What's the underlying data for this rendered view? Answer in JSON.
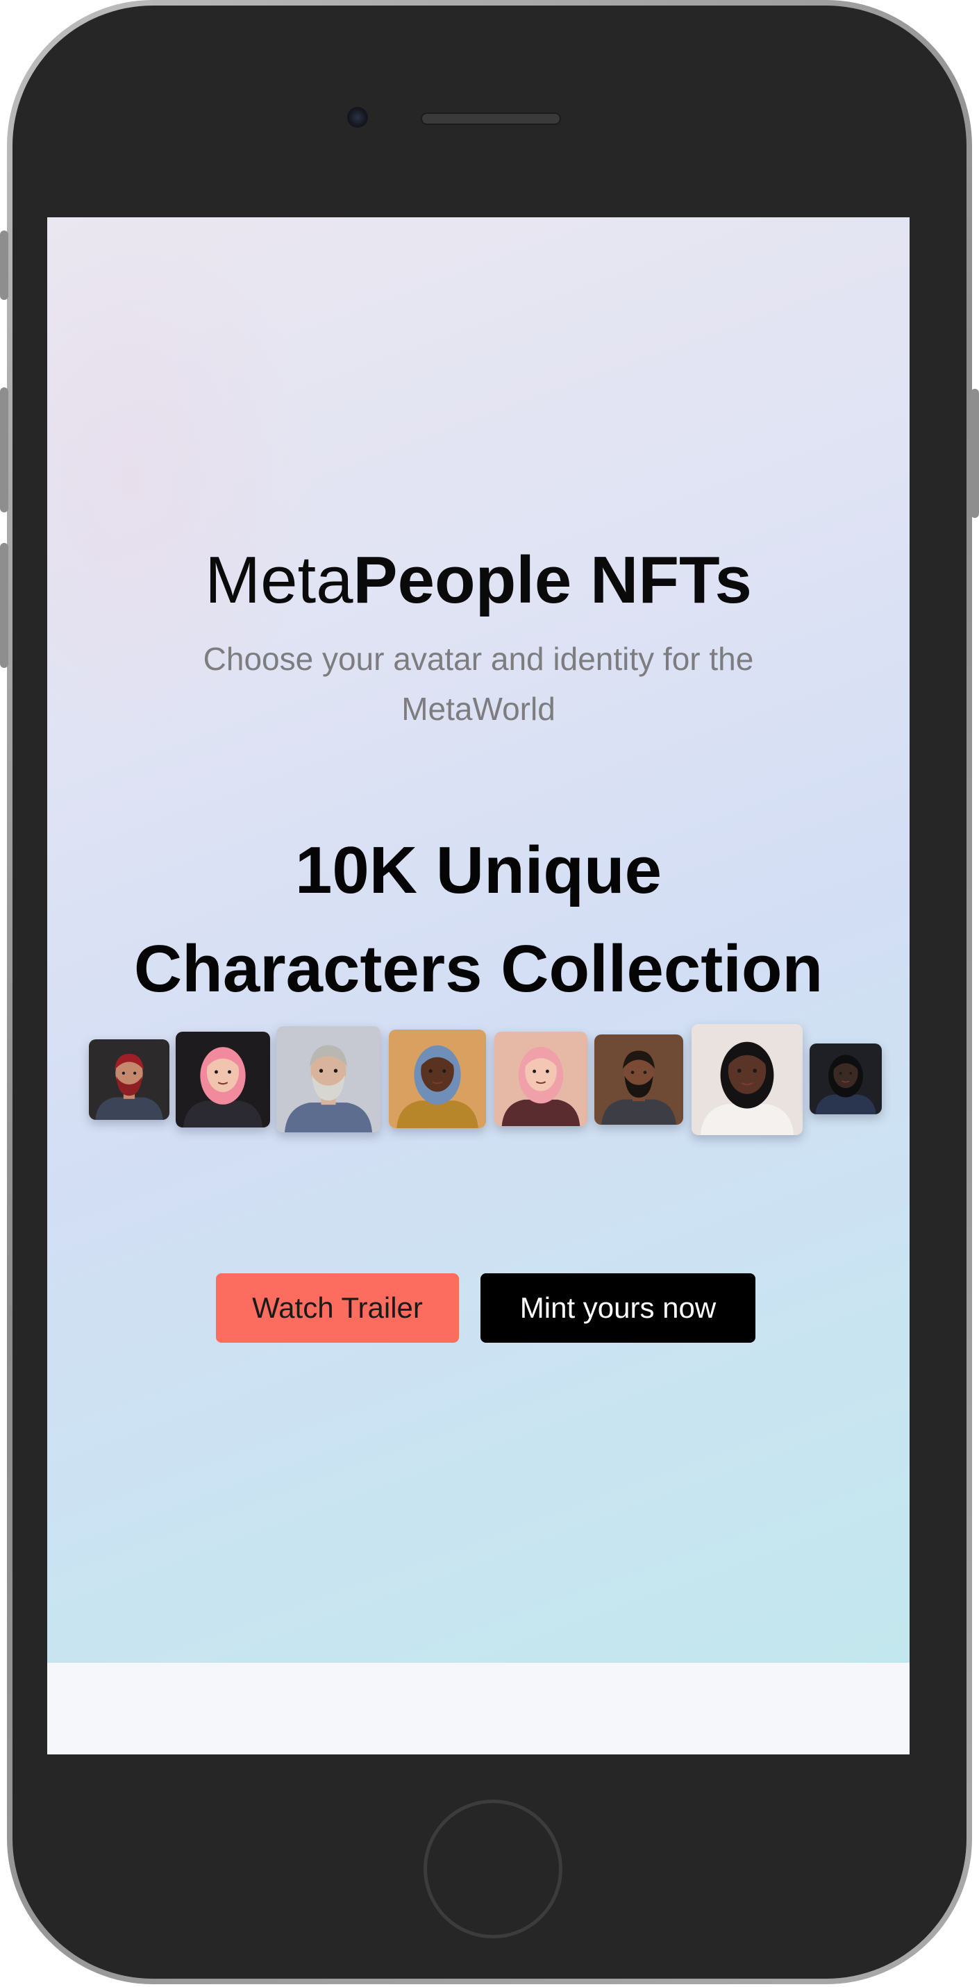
{
  "hero": {
    "title_light": "Meta",
    "title_bold": "People NFTs",
    "subtitle": "Choose your avatar and identity for the MetaWorld",
    "collection_line1": "10K Unique",
    "collection_line2": "Characters Collection"
  },
  "avatars": [
    {
      "name": "red-hair-bearded-man",
      "bg": "#2d2a2c",
      "hair": "#a01f26",
      "skin": "#c58a6e",
      "beard": "#8e1f22",
      "shirt": "#3c4458"
    },
    {
      "name": "pink-hair-woman",
      "bg": "#1e1b1f",
      "hair": "#f08a9c",
      "skin": "#f1c4b0",
      "beard": "",
      "shirt": "#2b2a33"
    },
    {
      "name": "grey-bearded-man",
      "bg": "#c7c9d2",
      "hair": "#b9b7b1",
      "skin": "#d8b49c",
      "beard": "#d8d6d0",
      "shirt": "#5c6d8f"
    },
    {
      "name": "woman-with-straw-hat",
      "bg": "#d9a060",
      "hair": "#6f8fb8",
      "skin": "#5a3220",
      "beard": "",
      "shirt": "#b8862a"
    },
    {
      "name": "pink-hair-woman-with-hat",
      "bg": "#e6b8a6",
      "hair": "#f0a0a8",
      "skin": "#f3c7b4",
      "beard": "",
      "shirt": "#5a2b2f"
    },
    {
      "name": "bald-bearded-man",
      "bg": "#6f4a35",
      "hair": "#1f1712",
      "skin": "#7a4a34",
      "beard": "#1a1410",
      "shirt": "#3d3d45"
    },
    {
      "name": "long-hair-woman",
      "bg": "#e9e2df",
      "hair": "#151213",
      "skin": "#5a3427",
      "beard": "",
      "shirt": "#f4f1ef"
    },
    {
      "name": "dark-hair-man",
      "bg": "#1f2026",
      "hair": "#0e0e10",
      "skin": "#3b2a24",
      "beard": "",
      "shirt": "#2a3550"
    }
  ],
  "buttons": {
    "trailer_label": "Watch Trailer",
    "mint_label": "Mint yours now"
  },
  "colors": {
    "trailer_bg": "#fc6d5f",
    "mint_bg": "#000000",
    "phone_body": "#262626"
  }
}
